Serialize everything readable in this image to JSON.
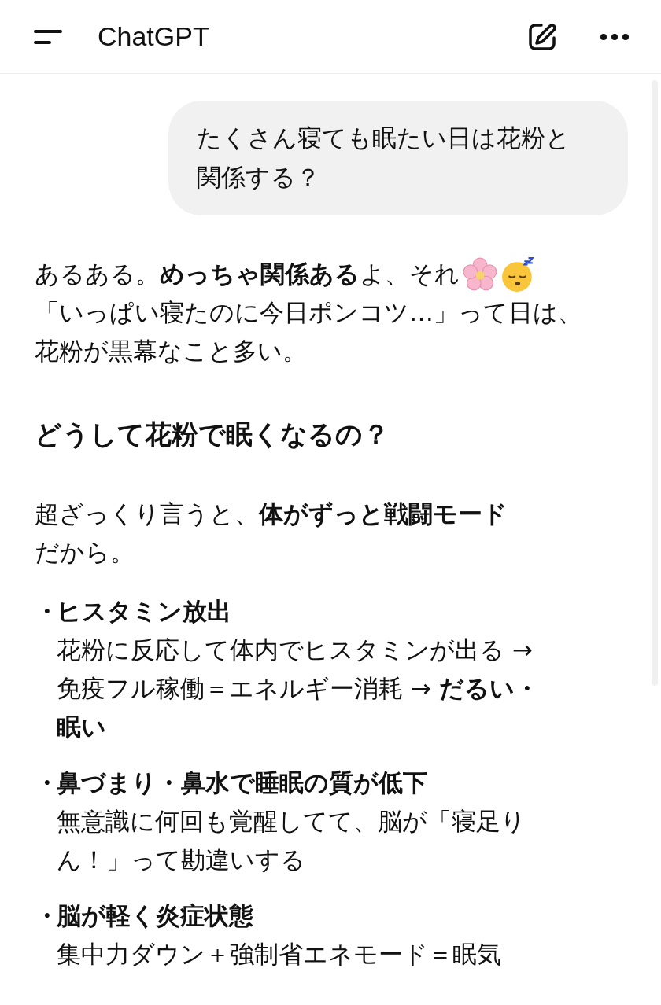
{
  "header": {
    "title": "ChatGPT"
  },
  "user_message": {
    "lines": [
      "たくさん寝ても眠たい日は花粉と",
      "関係する？"
    ]
  },
  "reply": {
    "intro_first": "あるある。**めっちゃ関係ある**よ、それ",
    "intro_rest": [
      "「いっぱい寝たのに今日ポンコツ…」って日は、",
      "花粉が黒幕なこと多い。"
    ],
    "heading": "どうして花粉で眠くなるの？",
    "summary": [
      "超ざっくり言うと、**体がずっと戦闘モード**",
      "だから。"
    ],
    "bullets": [
      {
        "marker": "・",
        "title": "ヒスタミン放出",
        "lines": [
          "花粉に反応して体内でヒスタミンが出る →",
          "免疫フル稼働＝エネルギー消耗 → **だるい・**",
          "**眠い**"
        ]
      },
      {
        "marker": "・",
        "title": "鼻づまり・鼻水で睡眠の質が低下",
        "lines": [
          "無意識に何回も覚醒してて、脳が「寝足り",
          "ん！」って勘違いする"
        ]
      },
      {
        "marker": "・",
        "title": "脳が軽く炎症状態",
        "lines": [
          "集中力ダウン＋強制省エネモード＝眠気"
        ]
      }
    ]
  }
}
